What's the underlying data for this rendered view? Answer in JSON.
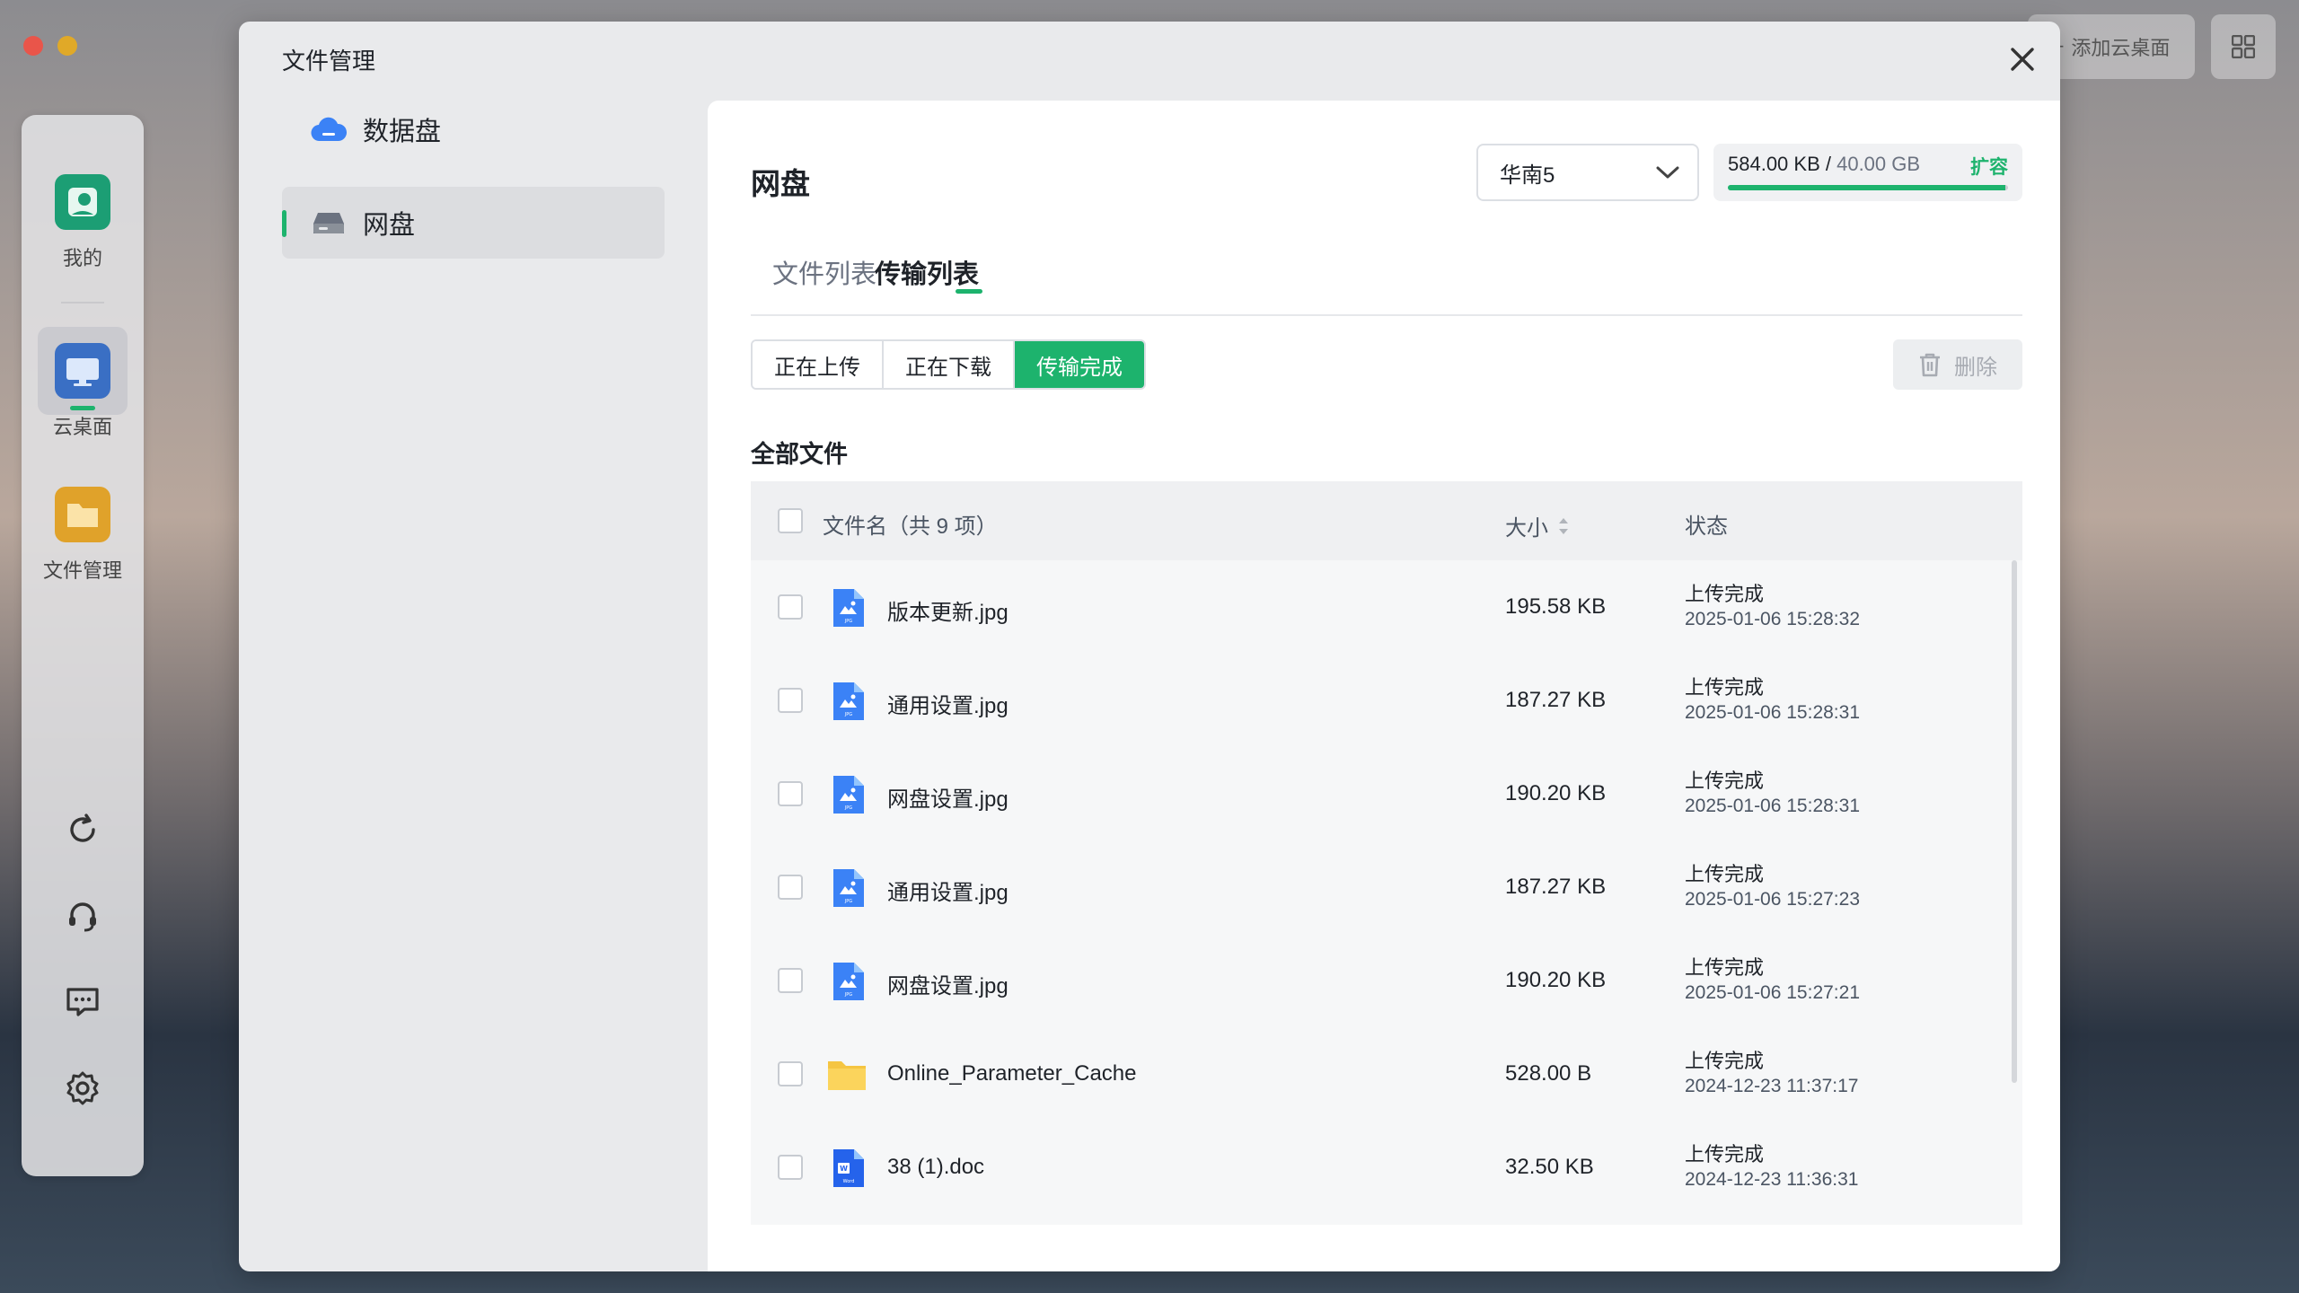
{
  "top_right": {
    "add_desktop_label": "添加云桌面"
  },
  "dock": {
    "items": [
      {
        "label": "我的"
      },
      {
        "label": "云桌面"
      },
      {
        "label": "文件管理"
      }
    ]
  },
  "modal": {
    "title": "文件管理",
    "sidebar": [
      {
        "label": "数据盘",
        "icon": "cloud-icon"
      },
      {
        "label": "网盘",
        "icon": "drive-icon"
      }
    ],
    "page_title": "网盘",
    "region": {
      "selected": "华南5"
    },
    "storage": {
      "used": "584.00 KB",
      "separator": " / ",
      "total": "40.00 GB",
      "expand_label": "扩容",
      "fill_percent": 99
    },
    "tabs": [
      {
        "label": "文件列表"
      },
      {
        "label": "传输列表"
      }
    ],
    "segments": [
      {
        "label": "正在上传"
      },
      {
        "label": "正在下载"
      },
      {
        "label": "传输完成"
      }
    ],
    "delete_label": "删除",
    "section_title": "全部文件",
    "table": {
      "col_name": "文件名（共 9 项）",
      "col_size": "大小",
      "col_status": "状态",
      "rows": [
        {
          "type": "jpg",
          "name": "版本更新.jpg",
          "size": "195.58 KB",
          "status": "上传完成",
          "time": "2025-01-06 15:28:32"
        },
        {
          "type": "jpg",
          "name": "通用设置.jpg",
          "size": "187.27 KB",
          "status": "上传完成",
          "time": "2025-01-06 15:28:31"
        },
        {
          "type": "jpg",
          "name": "网盘设置.jpg",
          "size": "190.20 KB",
          "status": "上传完成",
          "time": "2025-01-06 15:28:31"
        },
        {
          "type": "jpg",
          "name": "通用设置.jpg",
          "size": "187.27 KB",
          "status": "上传完成",
          "time": "2025-01-06 15:27:23"
        },
        {
          "type": "jpg",
          "name": "网盘设置.jpg",
          "size": "190.20 KB",
          "status": "上传完成",
          "time": "2025-01-06 15:27:21"
        },
        {
          "type": "folder",
          "name": "Online_Parameter_Cache",
          "size": "528.00 B",
          "status": "上传完成",
          "time": "2024-12-23 11:37:17"
        },
        {
          "type": "doc",
          "name": "38 (1).doc",
          "size": "32.50 KB",
          "status": "上传完成",
          "time": "2024-12-23 11:36:31"
        }
      ]
    }
  },
  "colors": {
    "accent": "#1db36d",
    "jpg_icon": "#3b82f6",
    "folder_icon": "#f5c542"
  }
}
